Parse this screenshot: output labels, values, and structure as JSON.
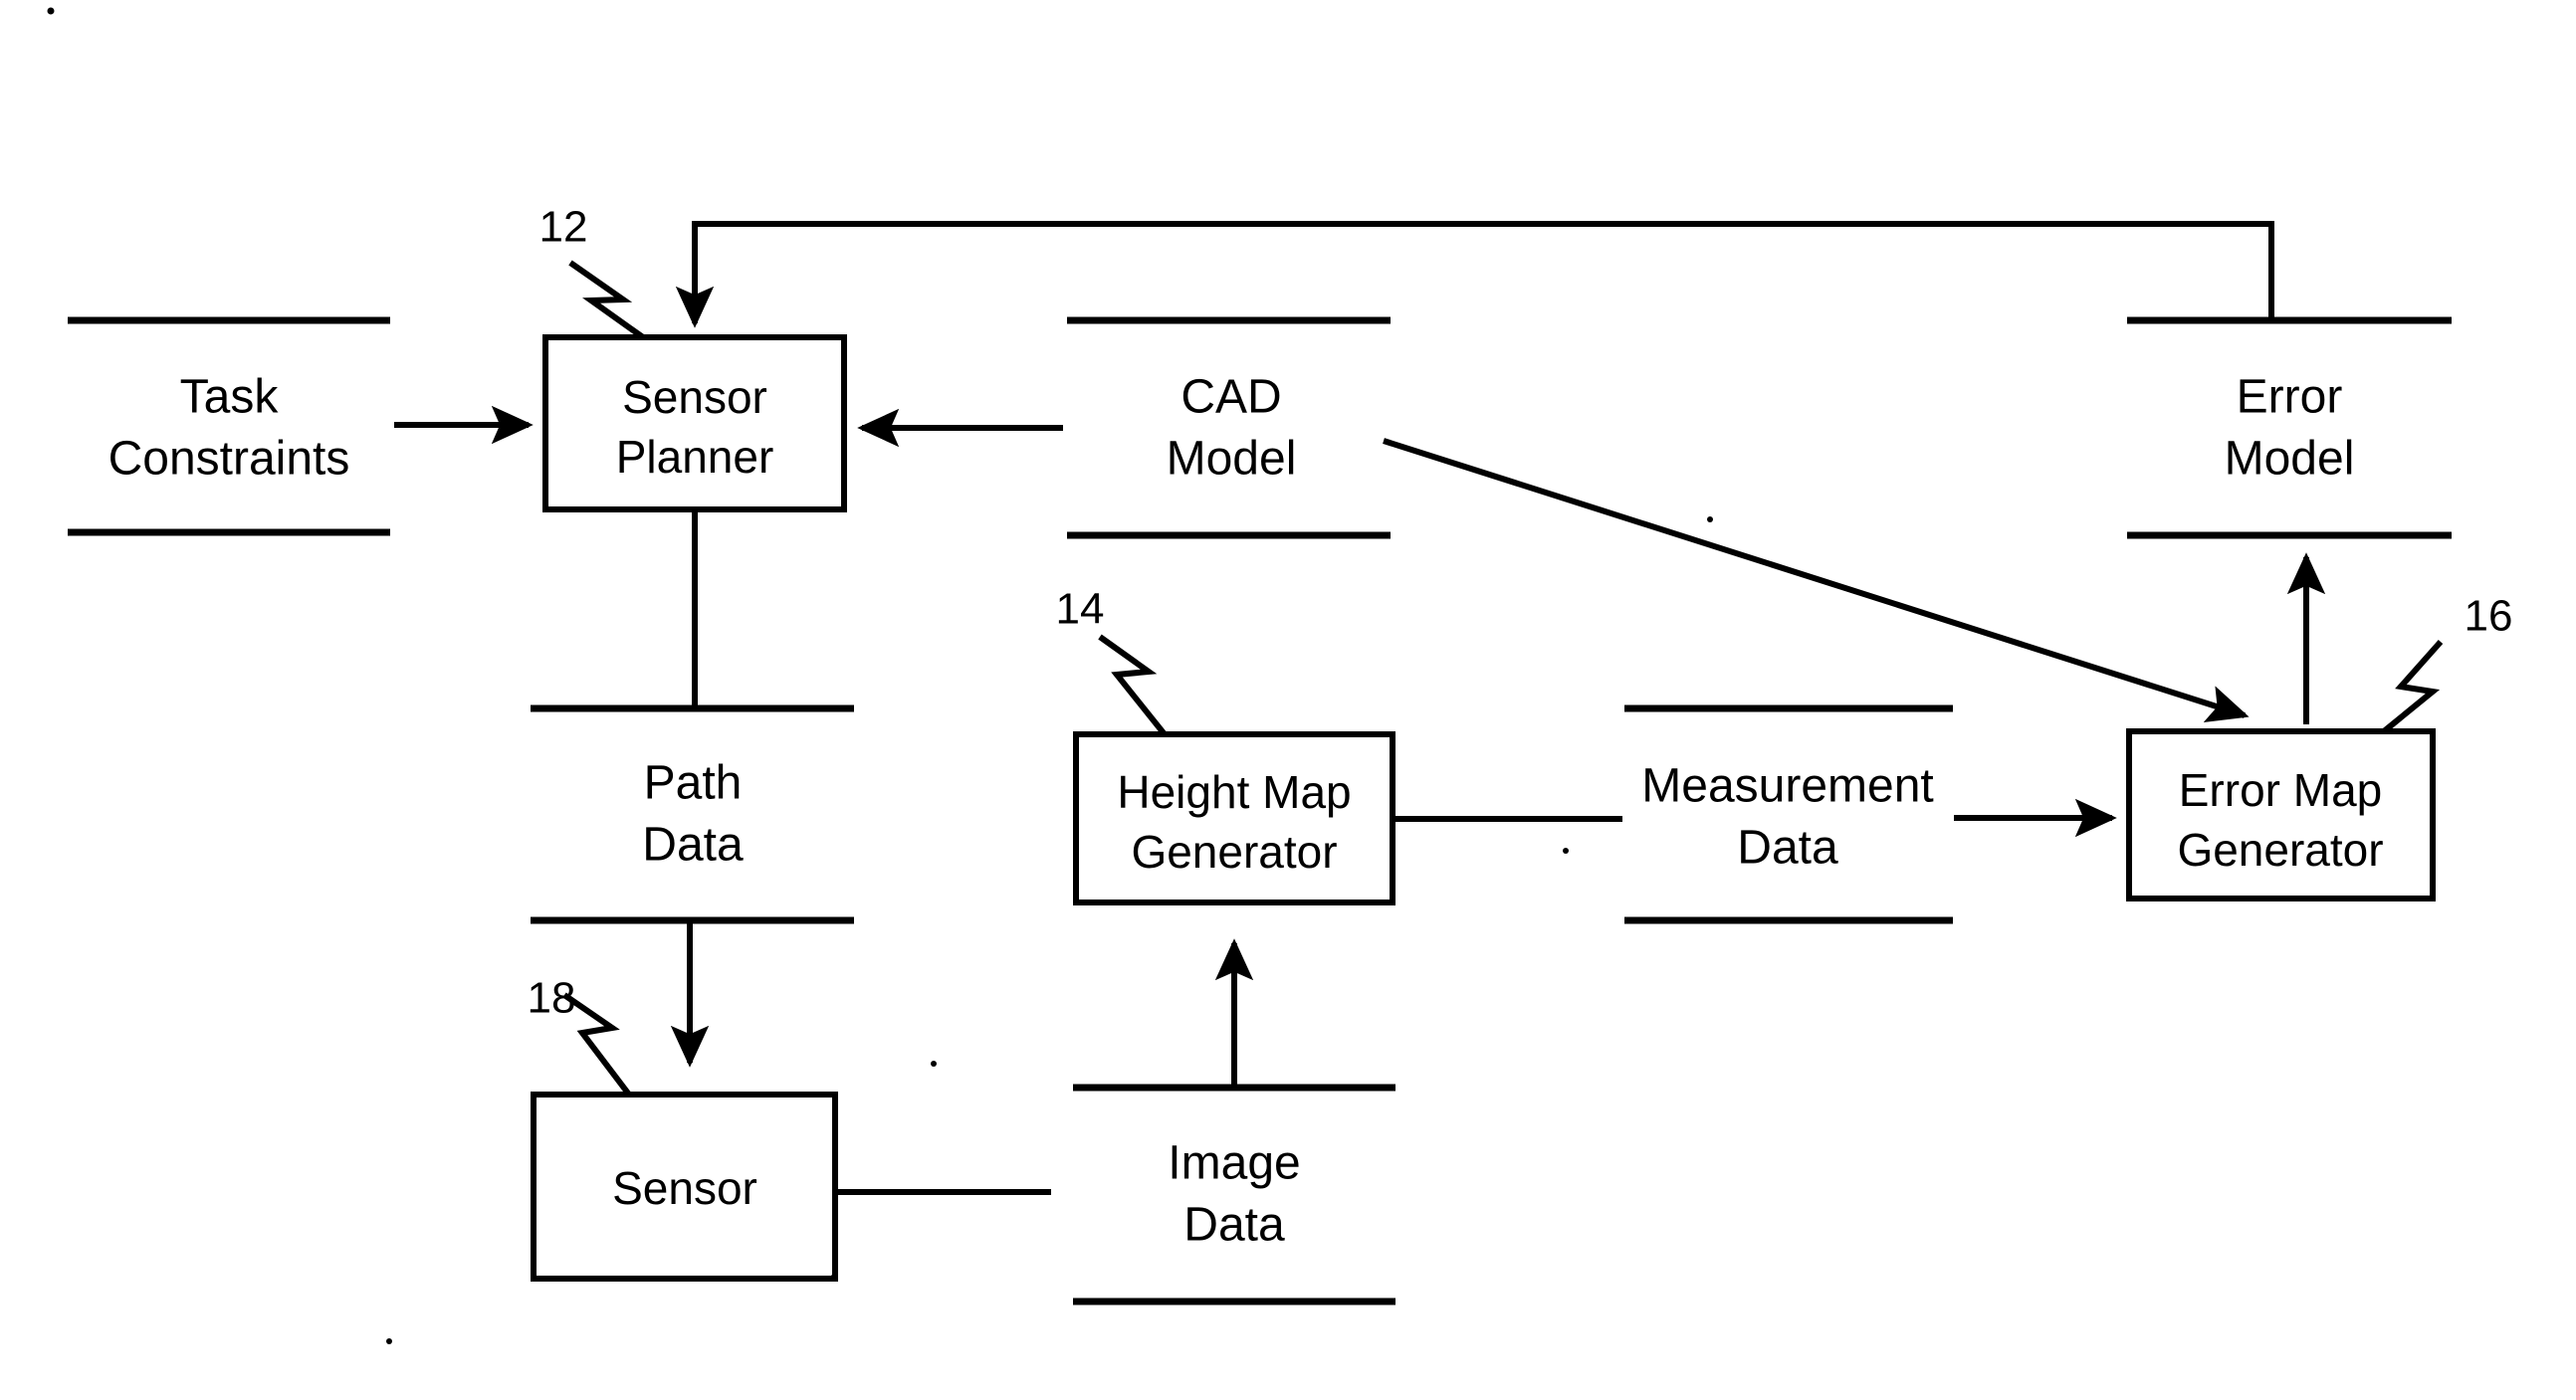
{
  "figure": {
    "type": "patent-block-diagram",
    "background_color": "#ffffff",
    "line_color": "#000000"
  },
  "processes": [
    {
      "id": "sensor-planner",
      "label_line1": "Sensor",
      "label_line2": "Planner",
      "ref_number": "12"
    },
    {
      "id": "height-map-generator",
      "label_line1": "Height Map",
      "label_line2": "Generator",
      "ref_number": "14"
    },
    {
      "id": "error-map-generator",
      "label_line1": "Error Map",
      "label_line2": "Generator",
      "ref_number": "16"
    },
    {
      "id": "sensor",
      "label_line1": "Sensor",
      "label_line2": "",
      "ref_number": "18"
    }
  ],
  "data_stores": [
    {
      "id": "task-constraints",
      "label_line1": "Task",
      "label_line2": "Constraints"
    },
    {
      "id": "cad-model",
      "label_line1": "CAD",
      "label_line2": "Model"
    },
    {
      "id": "error-model",
      "label_line1": "Error",
      "label_line2": "Model"
    },
    {
      "id": "path-data",
      "label_line1": "Path",
      "label_line2": "Data"
    },
    {
      "id": "measurement-data",
      "label_line1": "Measurement",
      "label_line2": "Data"
    },
    {
      "id": "image-data",
      "label_line1": "Image",
      "label_line2": "Data"
    }
  ],
  "connections": [
    {
      "id": "task-constraints-to-sensor-planner",
      "from": "task-constraints",
      "to": "sensor-planner",
      "arrow": true
    },
    {
      "id": "cad-model-to-sensor-planner",
      "from": "cad-model",
      "to": "sensor-planner",
      "arrow": true
    },
    {
      "id": "error-model-to-sensor-planner",
      "from": "error-model",
      "to": "sensor-planner",
      "arrow": true
    },
    {
      "id": "sensor-planner-to-path-data",
      "from": "sensor-planner",
      "to": "path-data",
      "arrow": false
    },
    {
      "id": "path-data-to-sensor",
      "from": "path-data",
      "to": "sensor",
      "arrow": true
    },
    {
      "id": "sensor-to-image-data",
      "from": "sensor",
      "to": "image-data",
      "arrow": false
    },
    {
      "id": "image-data-to-height-map-generator",
      "from": "image-data",
      "to": "height-map-generator",
      "arrow": true
    },
    {
      "id": "height-map-generator-to-measurement-data",
      "from": "height-map-generator",
      "to": "measurement-data",
      "arrow": false
    },
    {
      "id": "measurement-data-to-error-map-generator",
      "from": "measurement-data",
      "to": "error-map-generator",
      "arrow": true
    },
    {
      "id": "cad-model-to-error-map-generator",
      "from": "cad-model",
      "to": "error-map-generator",
      "arrow": true
    },
    {
      "id": "error-map-generator-to-error-model",
      "from": "error-map-generator",
      "to": "error-model",
      "arrow": true
    }
  ]
}
